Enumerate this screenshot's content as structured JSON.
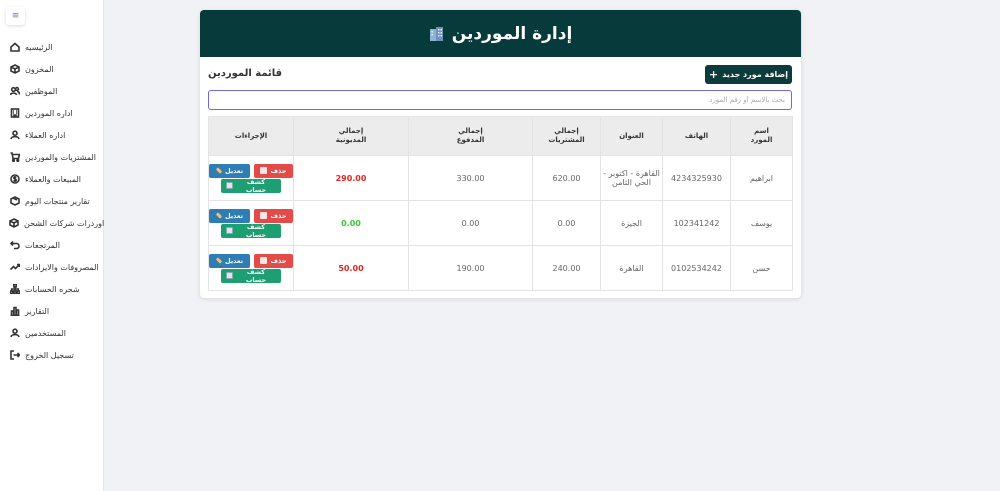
{
  "sidebar": {
    "toggle_icon": "≡",
    "items": [
      {
        "label": "الرئيسيه",
        "icon": "home-icon"
      },
      {
        "label": "المخزون",
        "icon": "box-icon"
      },
      {
        "label": "الموظفين",
        "icon": "users-icon"
      },
      {
        "label": "اداره الموردين",
        "icon": "building-icon"
      },
      {
        "label": "اداره العملاء",
        "icon": "user-icon"
      },
      {
        "label": "المشتريات والموردين",
        "icon": "cart-icon"
      },
      {
        "label": "المبيعات والعملاء",
        "icon": "dollar-icon"
      },
      {
        "label": "تقارير منتجات اليوم",
        "icon": "package-icon"
      },
      {
        "label": "اوردرات شركات الشحن",
        "icon": "box-icon"
      },
      {
        "label": "المرتجعات",
        "icon": "return-icon"
      },
      {
        "label": "المصروفات والايرادات",
        "icon": "trend-icon"
      },
      {
        "label": "شجره الحسابات",
        "icon": "tree-icon"
      },
      {
        "label": "التقارير",
        "icon": "bars-icon"
      },
      {
        "label": "المستخدمين",
        "icon": "user-icon"
      },
      {
        "label": "تسجيل الخروج",
        "icon": "logout-icon"
      }
    ]
  },
  "header": {
    "title": "إدارة الموردين",
    "icon": "building-icon"
  },
  "toolbar": {
    "add_label": "إضافة مورد جديد",
    "list_title": "قائمة الموردين"
  },
  "search": {
    "placeholder": "بحث بالاسم أو رقم المورد",
    "value": ""
  },
  "table": {
    "headers": [
      "الإجراءات",
      "إجمالي المديونية",
      "إجمالي المدفوع",
      "إجمالي المشتريات",
      "العنوان",
      "الهاتف",
      "اسم المورد"
    ],
    "header_lines": [
      [
        "الإجراءات",
        ""
      ],
      [
        "إجمالي",
        "المديونية"
      ],
      [
        "إجمالي",
        "المدفوع"
      ],
      [
        "إجمالي",
        "المشتريات"
      ],
      [
        "العنوان",
        ""
      ],
      [
        "الهاتف",
        ""
      ],
      [
        "اسم",
        "المورد"
      ]
    ],
    "actions": {
      "delete": "حذف",
      "edit": "تعديل",
      "statement": "كشف حساب"
    },
    "rows": [
      {
        "debt": "290.00",
        "debt_status": "red",
        "paid": "330.00",
        "purchases": "620.00",
        "address": "القاهرة - اكتوبر - الحي الثامن",
        "phone": "4234325930",
        "name": "ابراهيم"
      },
      {
        "debt": "0.00",
        "debt_status": "green",
        "paid": "0.00",
        "purchases": "0.00",
        "address": "الجيزة",
        "phone": "102341242",
        "name": "يوسف"
      },
      {
        "debt": "50.00",
        "debt_status": "red",
        "paid": "190.00",
        "purchases": "240.00",
        "address": "القاهرة",
        "phone": "0102534242",
        "name": "حسن"
      }
    ]
  },
  "colors": {
    "header_bg": "#073a3b",
    "add_button": "#0b3b3a",
    "delete_button": "#e24b48",
    "edit_button": "#2e7db5",
    "statement_button": "#1e9f72",
    "debt_red": "#e5261f",
    "debt_green": "#36c636",
    "search_border": "#6d6ae0"
  }
}
